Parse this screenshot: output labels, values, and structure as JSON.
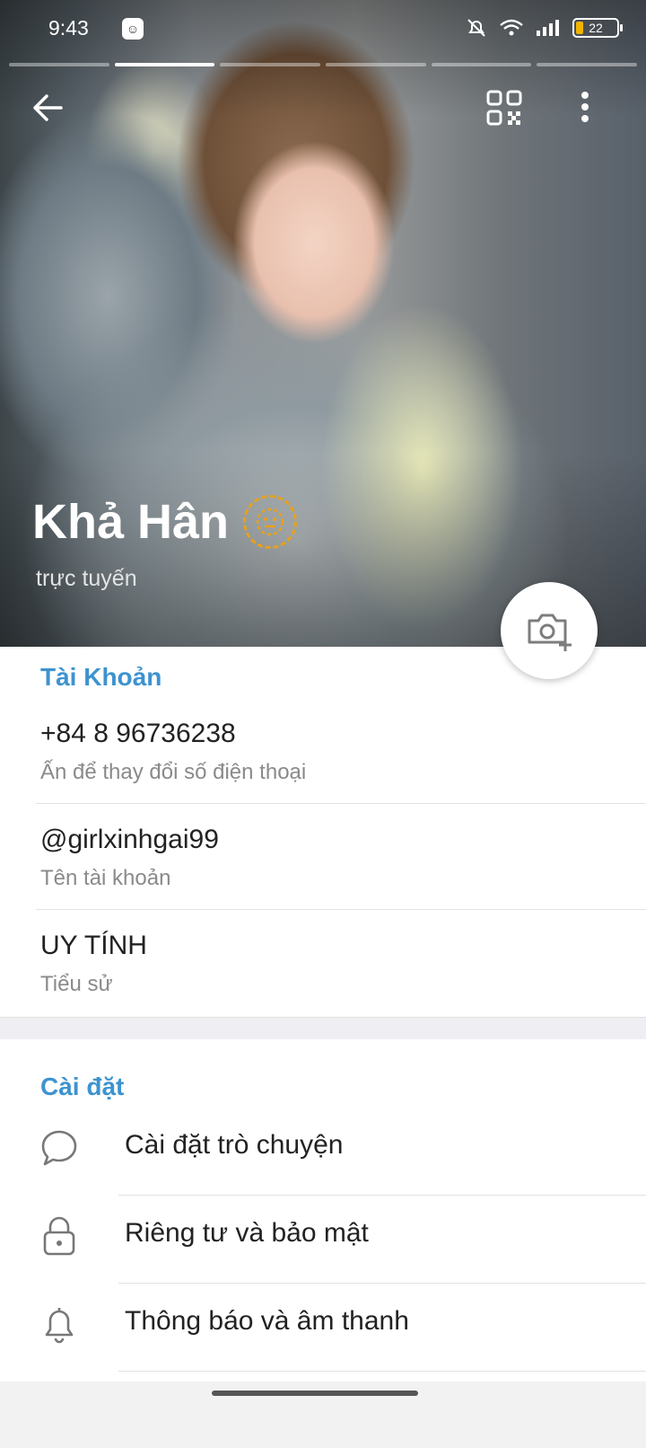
{
  "status_bar": {
    "time": "9:43",
    "battery": "22",
    "icons": [
      "app-notification-icon",
      "mute-icon",
      "wifi-icon",
      "signal-icon",
      "battery-icon"
    ]
  },
  "header": {
    "story_segments": 6,
    "active_segment": 2,
    "back_icon": "arrow-left-icon",
    "qr_icon": "qr-code-icon",
    "more_icon": "more-vertical-icon",
    "name": "Khả Hân",
    "status": "trực tuyến",
    "camera_icon": "camera-add-icon"
  },
  "account": {
    "title": "Tài Khoản",
    "phone": "+84 8 96736238",
    "phone_hint": "Ấn để thay đổi số điện thoại",
    "username": "@girlxinhgai99",
    "username_hint": "Tên tài khoản",
    "bio": "UY TÍNH",
    "bio_hint": "Tiểu sử"
  },
  "settings": {
    "title": "Cài đặt",
    "items": [
      {
        "label": "Cài đặt trò chuyện",
        "icon": "chat-bubble-icon"
      },
      {
        "label": "Riêng tư và bảo mật",
        "icon": "lock-icon"
      },
      {
        "label": "Thông báo và âm thanh",
        "icon": "bell-icon"
      }
    ]
  },
  "colors": {
    "accent": "#3d93cf",
    "badge_outline": "#e6a11d"
  }
}
